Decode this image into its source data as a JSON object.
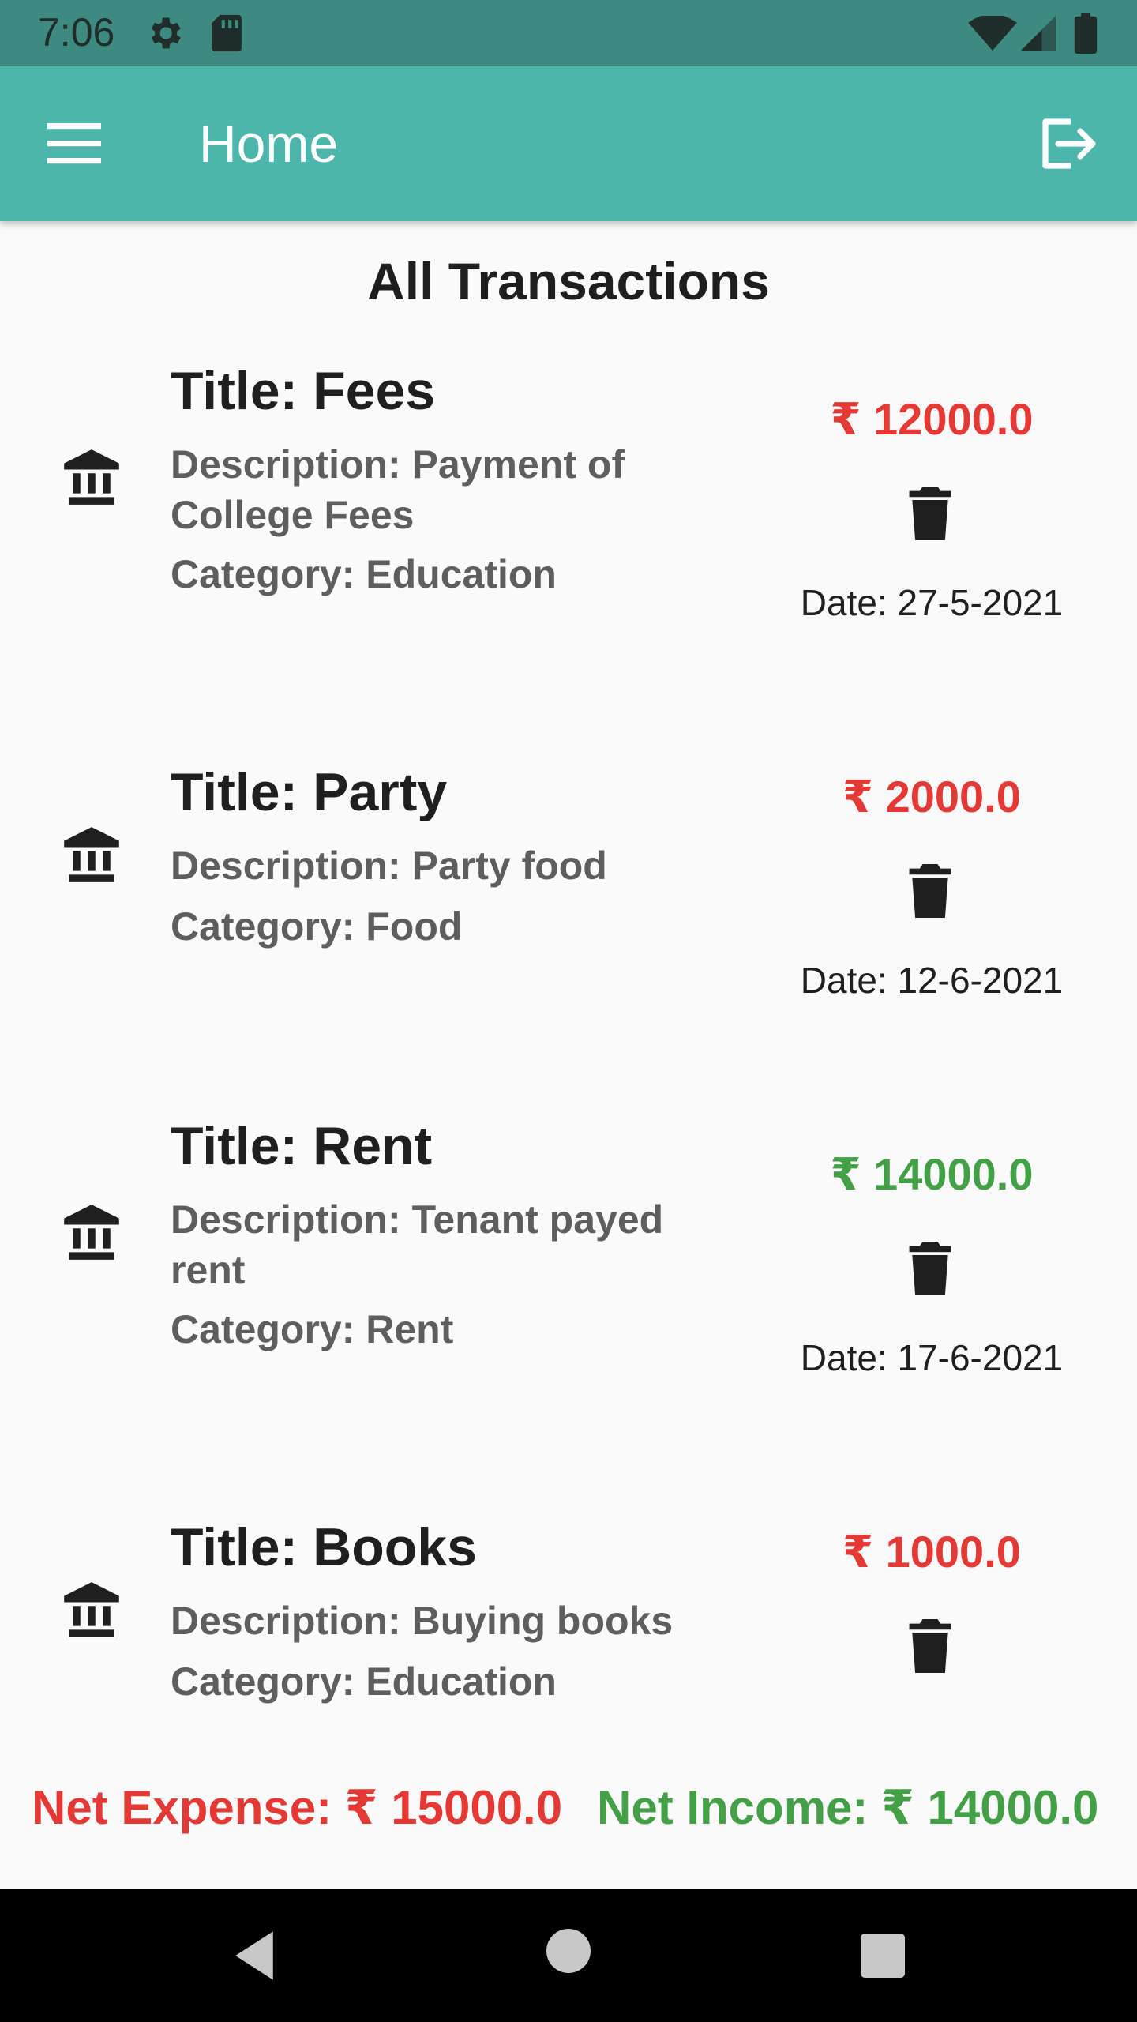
{
  "status_bar": {
    "time": "7:06",
    "icons": [
      "gear-icon",
      "sd-card-icon",
      "wifi-icon",
      "cell-signal-icon",
      "battery-icon"
    ]
  },
  "app_bar": {
    "title": "Home",
    "menu_icon": "hamburger-menu-icon",
    "logout_icon": "logout-icon",
    "color": "#4db6ac"
  },
  "heading": "All Transactions",
  "colors": {
    "expense": "#e53935",
    "income": "#43a047"
  },
  "transactions": [
    {
      "title": "Title: Fees",
      "description": "Description: Payment of College Fees",
      "category": "Category: Education",
      "amount": "₹ 12000.0",
      "type": "expense",
      "date": "Date: 27-5-2021"
    },
    {
      "title": "Title: Party",
      "description": "Description: Party food",
      "category": "Category: Food",
      "amount": "₹ 2000.0",
      "type": "expense",
      "date": "Date: 12-6-2021"
    },
    {
      "title": "Title: Rent",
      "description": "Description: Tenant payed rent",
      "category": "Category: Rent",
      "amount": "₹ 14000.0",
      "type": "income",
      "date": "Date: 17-6-2021"
    },
    {
      "title": "Title: Books",
      "description": "Description: Buying books",
      "category": "Category: Education",
      "amount": "₹ 1000.0",
      "type": "expense",
      "date": ""
    }
  ],
  "totals": {
    "net_expense": "Net Expense: ₹ 15000.0",
    "net_income": "Net Income: ₹ 14000.0"
  }
}
